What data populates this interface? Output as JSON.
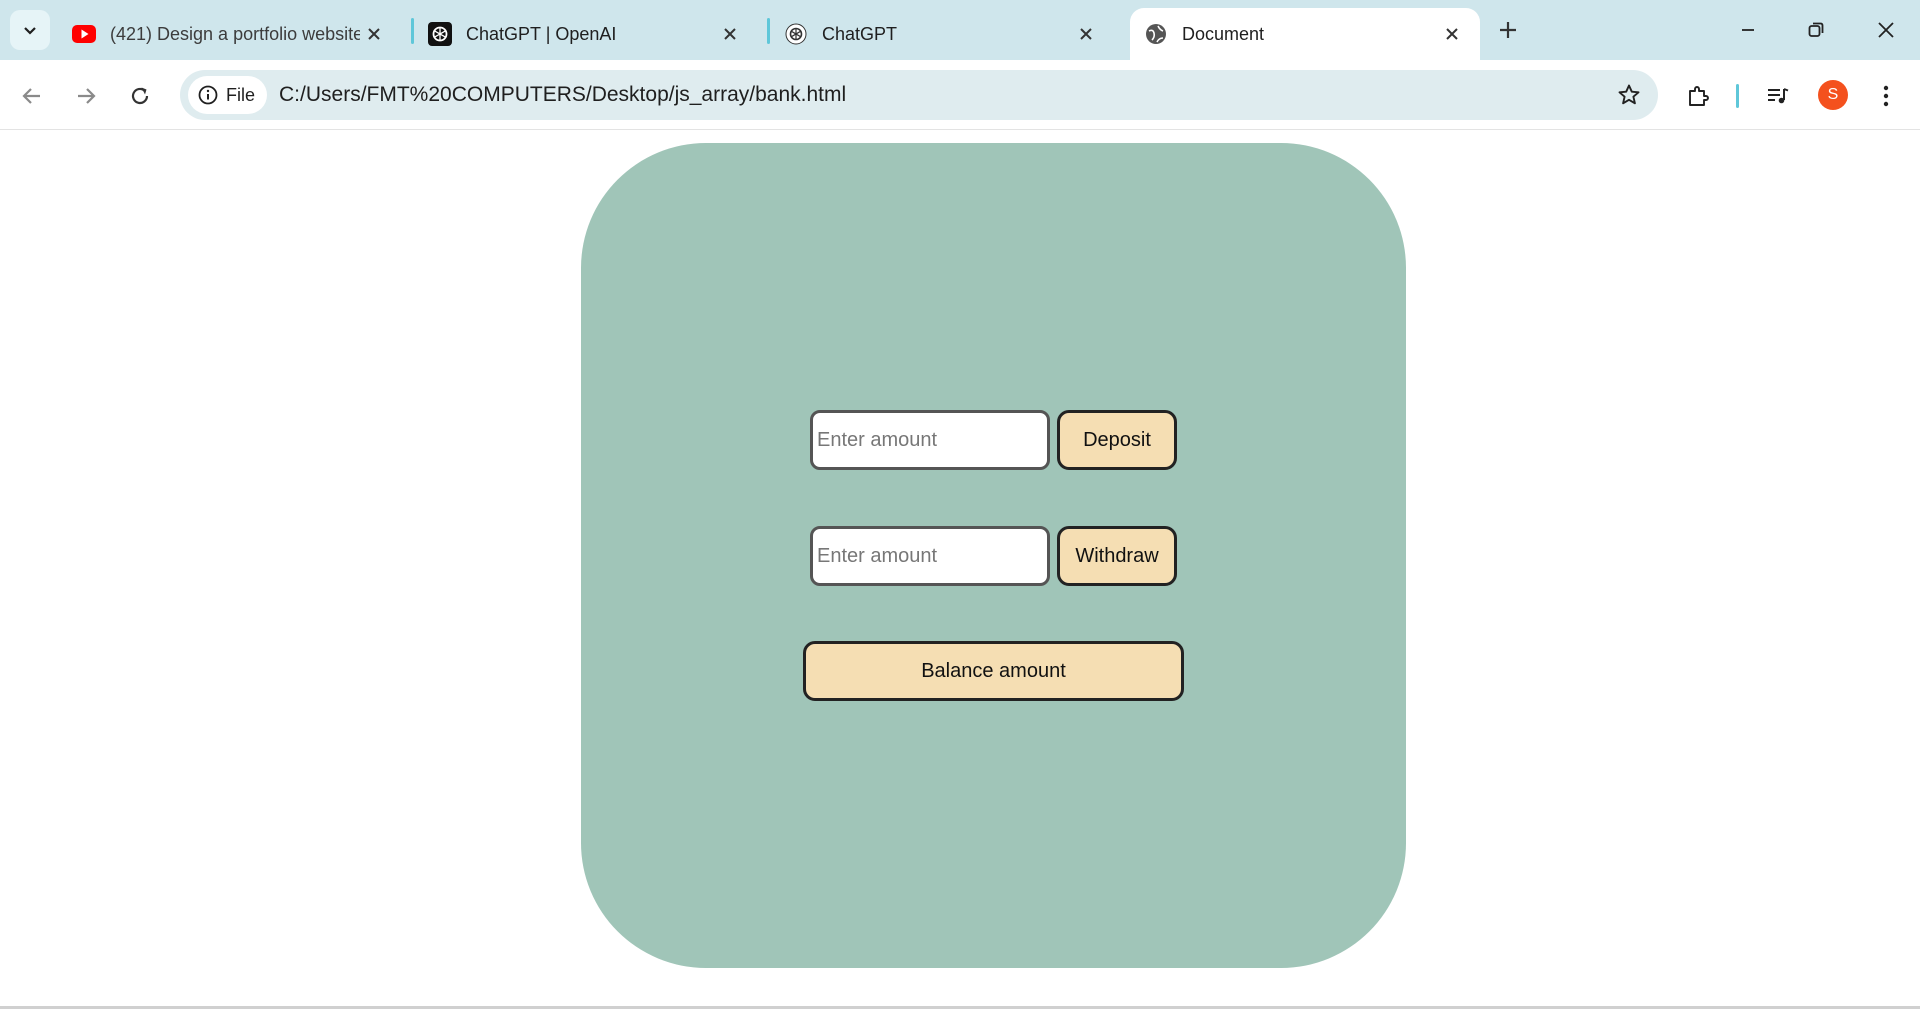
{
  "browser": {
    "tabs": [
      {
        "title": "(421) Design a portfolio website",
        "icon": "youtube-icon",
        "active": false
      },
      {
        "title": "ChatGPT | OpenAI",
        "icon": "openai-icon",
        "active": false
      },
      {
        "title": "ChatGPT",
        "icon": "openai-icon",
        "active": false
      },
      {
        "title": "Document",
        "icon": "globe-icon",
        "active": true
      }
    ],
    "site_chip_label": "File",
    "url": "C:/Users/FMT%20COMPUTERS/Desktop/js_array/bank.html",
    "profile_initial": "S"
  },
  "page": {
    "deposit": {
      "placeholder": "Enter amount",
      "button_label": "Deposit"
    },
    "withdraw": {
      "placeholder": "Enter amount",
      "button_label": "Withdraw"
    },
    "balance_button_label": "Balance amount"
  },
  "colors": {
    "card_background": "#a0c5b8",
    "button_background": "#f5deb3",
    "tabstrip": "#cfe6ec",
    "avatar": "#f4511e"
  }
}
